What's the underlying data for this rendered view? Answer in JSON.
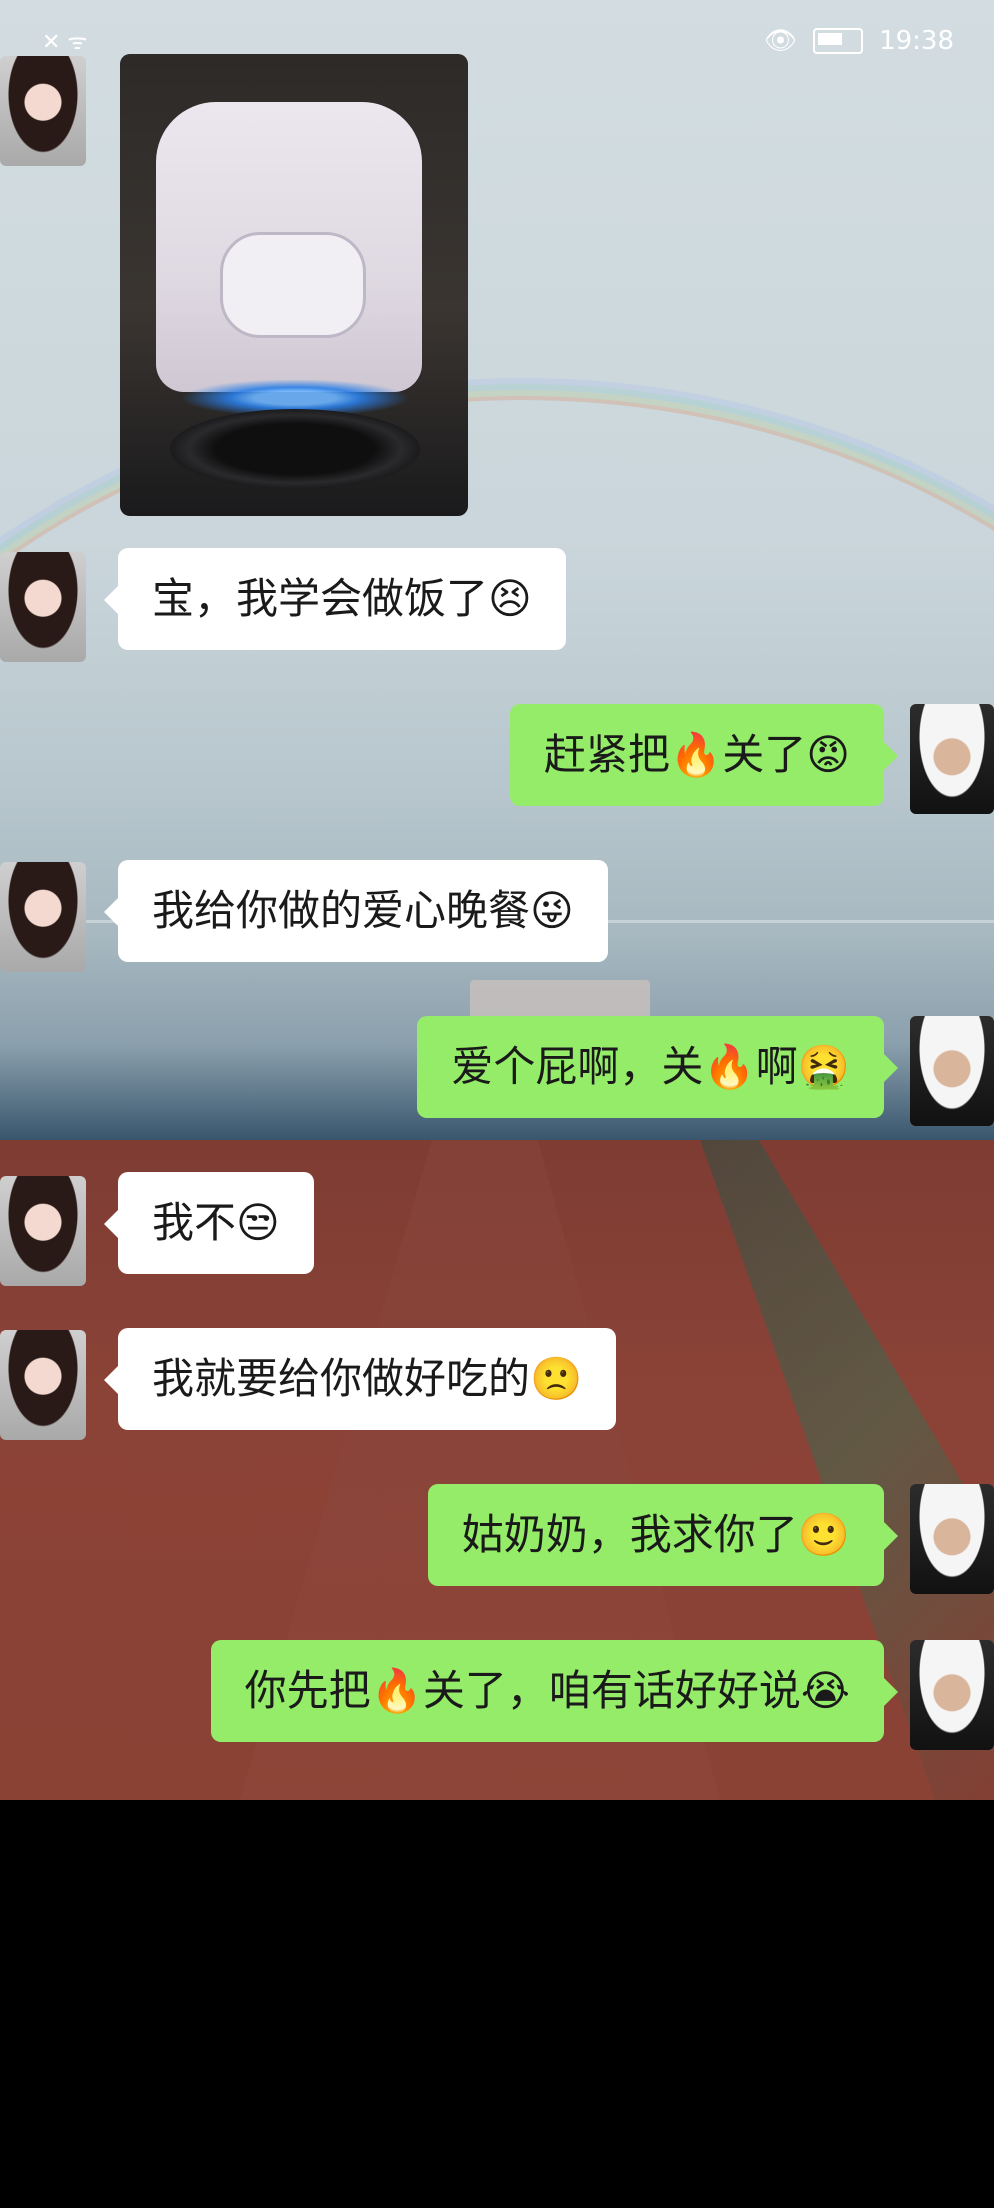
{
  "status_bar": {
    "time": "19:38",
    "icons": [
      "no-signal-icon",
      "wifi-icon",
      "eye-icon",
      "battery-icon"
    ]
  },
  "chat": {
    "messages": [
      {
        "from": "her",
        "type": "image",
        "image_desc": "rice-cooker-on-gas-stove"
      },
      {
        "from": "her",
        "type": "text",
        "text": "宝，我学会做饭了😣"
      },
      {
        "from": "me",
        "type": "text",
        "text": "赶紧把🔥关了😡"
      },
      {
        "from": "her",
        "type": "text",
        "text": "我给你做的爱心晚餐😜"
      },
      {
        "from": "me",
        "type": "text",
        "text": "爱个屁啊，关🔥啊🤮"
      },
      {
        "from": "her",
        "type": "text",
        "text": "我不😒"
      },
      {
        "from": "her",
        "type": "text",
        "text": "我就要给你做好吃的🙁"
      },
      {
        "from": "me",
        "type": "text",
        "text": "姑奶奶，我求你了🙂"
      },
      {
        "from": "me",
        "type": "text",
        "text": "你先把🔥关了，咱有话好好说😭"
      }
    ]
  },
  "colors": {
    "outgoing_bubble": "#95ec69",
    "incoming_bubble": "#ffffff"
  }
}
